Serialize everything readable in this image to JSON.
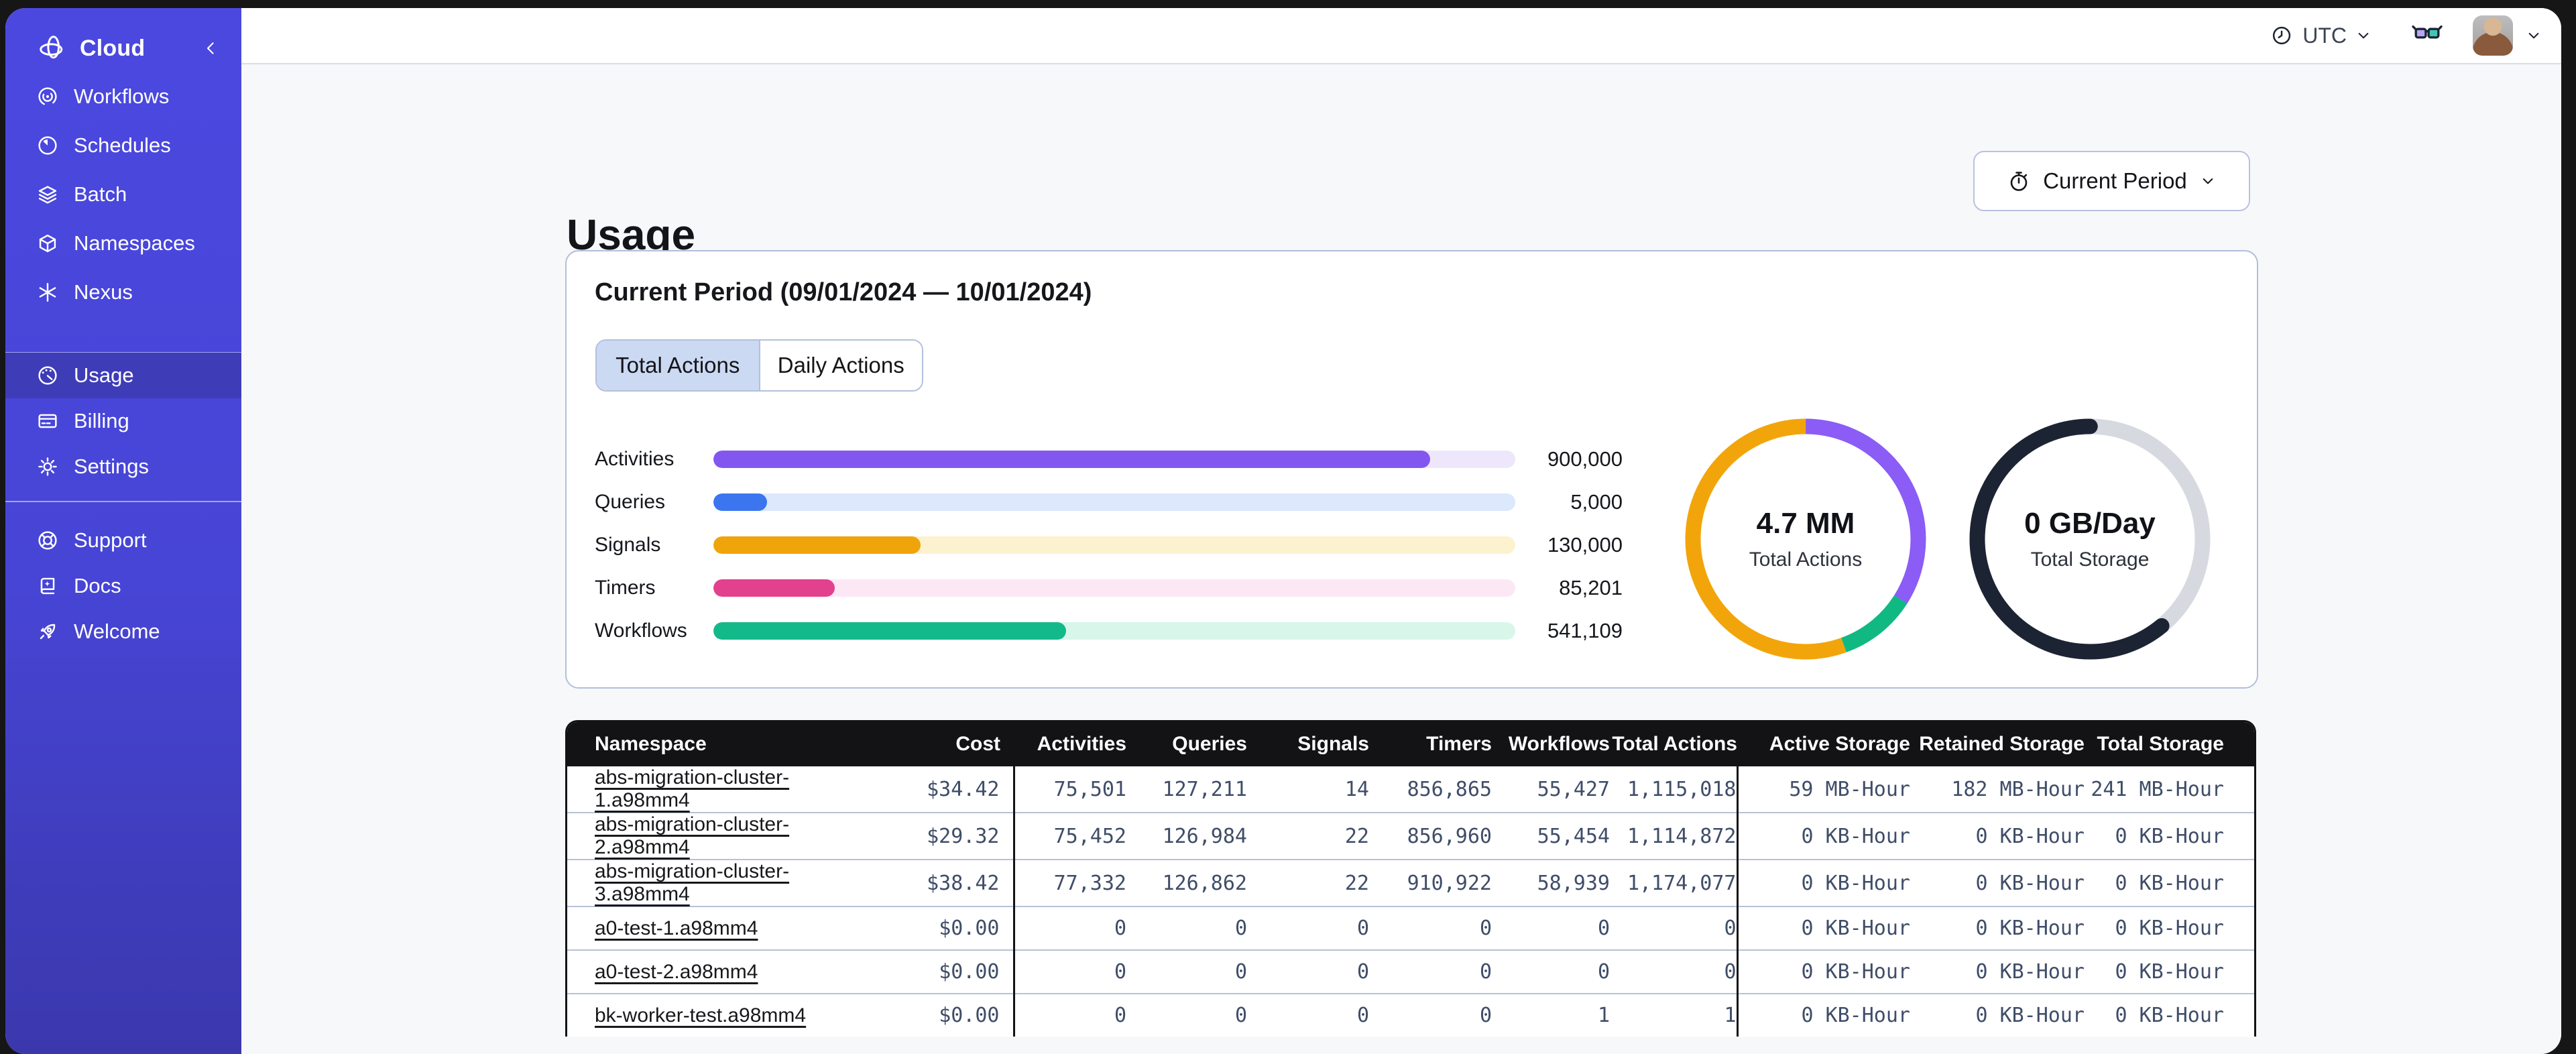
{
  "topbar": {
    "timezone_label": "UTC"
  },
  "sidebar": {
    "brand": {
      "label": "Cloud",
      "icon": "temporal-logo",
      "collapse_icon": "chevron-left"
    },
    "nav_main": [
      {
        "label": "Workflows",
        "icon": "workflows",
        "active": false
      },
      {
        "label": "Schedules",
        "icon": "schedules",
        "active": false
      },
      {
        "label": "Batch",
        "icon": "batch",
        "active": false
      },
      {
        "label": "Namespaces",
        "icon": "namespaces",
        "active": false
      },
      {
        "label": "Nexus",
        "icon": "nexus",
        "active": false
      }
    ],
    "nav_account": [
      {
        "label": "Usage",
        "icon": "usage",
        "active": true
      },
      {
        "label": "Billing",
        "icon": "billing",
        "active": false
      },
      {
        "label": "Settings",
        "icon": "settings",
        "active": false
      }
    ],
    "nav_footer": [
      {
        "label": "Support",
        "icon": "support",
        "active": false
      },
      {
        "label": "Docs",
        "icon": "docs",
        "active": false
      },
      {
        "label": "Welcome",
        "icon": "welcome",
        "active": false
      }
    ]
  },
  "page": {
    "title": "Usage",
    "period_button": {
      "label": "Current Period",
      "icon": "stopwatch"
    }
  },
  "usage_card": {
    "title": "Current Period (09/01/2024 — 10/01/2024)",
    "tabs": [
      {
        "label": "Total Actions",
        "selected": true
      },
      {
        "label": "Daily Actions",
        "selected": false
      }
    ],
    "chart_data": {
      "type": "bar",
      "categories": [
        "Activities",
        "Queries",
        "Signals",
        "Timers",
        "Workflows"
      ],
      "values": [
        900000,
        5000,
        130000,
        85201,
        541109
      ],
      "value_labels": [
        "900,000",
        "5,000",
        "130,000",
        "85,201",
        "541,109"
      ],
      "fill_pcts": [
        89.4,
        6.7,
        25.8,
        15.1,
        44
      ],
      "bar_colors": [
        "#8257f0",
        "#3b76f0",
        "#f0a40b",
        "#e2418e",
        "#14b98a"
      ],
      "track_colors": [
        "#eee7fb",
        "#dce8fb",
        "#fcf2cf",
        "#fce8f5",
        "#d9f6eb"
      ]
    },
    "donuts": [
      {
        "name": "total-actions-donut",
        "center_value": "4.7 MM",
        "center_label": "Total Actions",
        "segments": [
          {
            "label": "activities",
            "color": "#8b5cf6",
            "pct": 34,
            "offset": 0
          },
          {
            "label": "workflows",
            "color": "#10b981",
            "pct": 10.5,
            "offset": 34
          },
          {
            "label": "other",
            "color": "#f2a50a",
            "pct": 55.5,
            "offset": 44.5
          }
        ]
      },
      {
        "name": "total-storage-donut",
        "center_value": "0 GB/Day",
        "center_label": "Total Storage",
        "segments": [
          {
            "label": "track",
            "color": "#d6d9df",
            "pct": 100,
            "offset": 0
          },
          {
            "label": "storage",
            "color": "#1c2433",
            "pct": 61,
            "offset": 39,
            "cap": "round"
          }
        ]
      }
    ]
  },
  "table": {
    "columns": [
      {
        "label": "Namespace"
      },
      {
        "label": "Cost"
      },
      {
        "label": "Activities"
      },
      {
        "label": "Queries"
      },
      {
        "label": "Signals"
      },
      {
        "label": "Timers"
      },
      {
        "label": "Workflows"
      },
      {
        "label": "Total Actions"
      },
      {
        "label": "Active Storage"
      },
      {
        "label": "Retained Storage"
      },
      {
        "label": "Total Storage"
      }
    ],
    "rows": [
      [
        "abs-migration-cluster-1.a98mm4",
        "$34.42",
        "75,501",
        "127,211",
        "14",
        "856,865",
        "55,427",
        "1,115,018",
        "59 MB-Hour",
        "182 MB-Hour",
        "241 MB-Hour"
      ],
      [
        "abs-migration-cluster-2.a98mm4",
        "$29.32",
        "75,452",
        "126,984",
        "22",
        "856,960",
        "55,454",
        "1,114,872",
        "0 KB-Hour",
        "0 KB-Hour",
        "0 KB-Hour"
      ],
      [
        "abs-migration-cluster-3.a98mm4",
        "$38.42",
        "77,332",
        "126,862",
        "22",
        "910,922",
        "58,939",
        "1,174,077",
        "0 KB-Hour",
        "0 KB-Hour",
        "0 KB-Hour"
      ],
      [
        "a0-test-1.a98mm4",
        "$0.00",
        "0",
        "0",
        "0",
        "0",
        "0",
        "0",
        "0 KB-Hour",
        "0 KB-Hour",
        "0 KB-Hour"
      ],
      [
        "a0-test-2.a98mm4",
        "$0.00",
        "0",
        "0",
        "0",
        "0",
        "0",
        "0",
        "0 KB-Hour",
        "0 KB-Hour",
        "0 KB-Hour"
      ],
      [
        "bk-worker-test.a98mm4",
        "$0.00",
        "0",
        "0",
        "0",
        "0",
        "1",
        "1",
        "0 KB-Hour",
        "0 KB-Hour",
        "0 KB-Hour"
      ]
    ]
  },
  "theme": {
    "sidebar_bg": "#4745d5",
    "sidebar_active_bg": "#3f3cb8",
    "page_bg": "#f7f8fa",
    "card_border": "#b3bedb",
    "tab_selected_bg": "#cbd9f3",
    "table_header_bg": "#131316",
    "glasses_left_lens": "#b7a5f7",
    "glasses_right_lens": "#3fc6b7"
  }
}
